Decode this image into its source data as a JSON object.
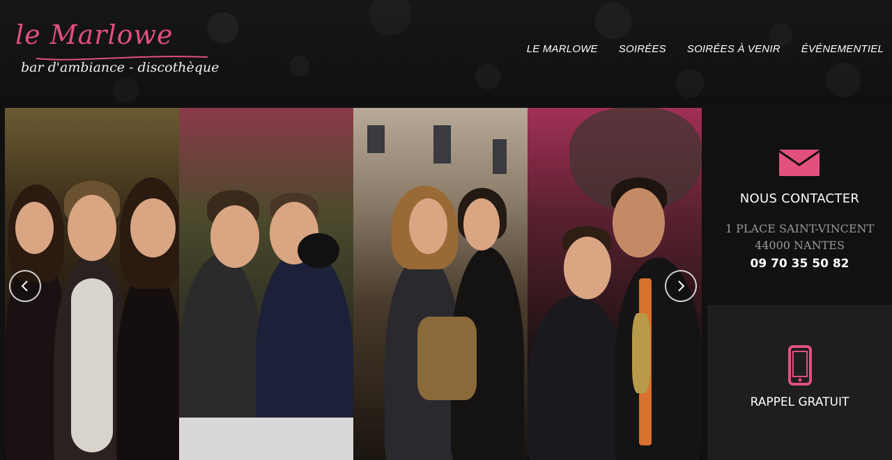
{
  "brand": {
    "name": "le Marlowe",
    "tagline": "bar d'ambiance - discothèque",
    "accent_color": "#e2507e"
  },
  "nav": {
    "items": [
      {
        "label": "LE MARLOWE"
      },
      {
        "label": "SOIRÉES"
      },
      {
        "label": "SOIRÉES À VENIR"
      },
      {
        "label": "ÉVÉNEMENTIEL"
      }
    ]
  },
  "gallery": {
    "prev_icon": "chevron-left-icon",
    "next_icon": "chevron-right-icon"
  },
  "contact": {
    "icon": "envelope-icon",
    "title": "NOUS CONTACTER",
    "address_line1": "1 PLACE SAINT-VINCENT",
    "address_line2": "44000 NANTES",
    "phone": "09 70 35 50 82"
  },
  "callback": {
    "icon": "mobile-phone-icon",
    "title": "RAPPEL GRATUIT"
  }
}
